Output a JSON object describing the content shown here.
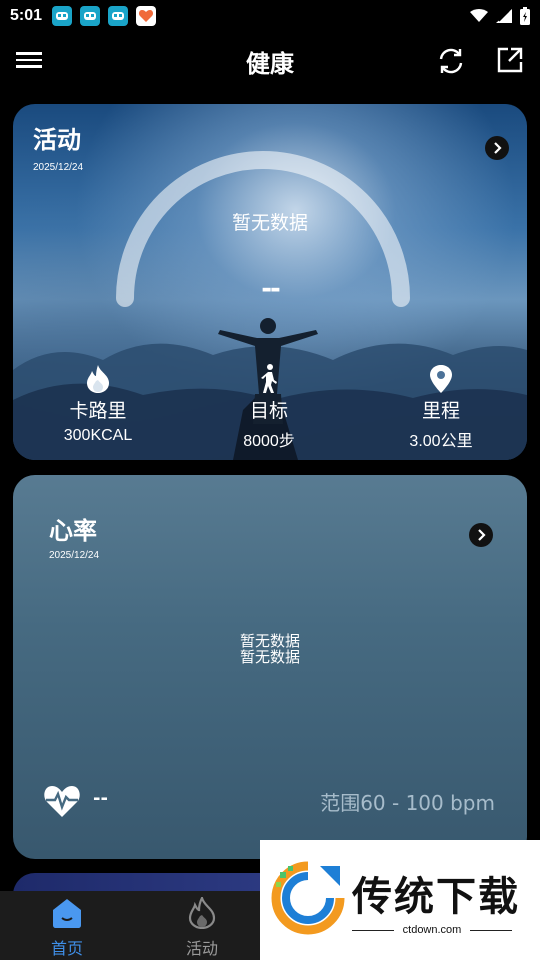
{
  "status_bar": {
    "time": "5:01"
  },
  "header": {
    "title": "健康"
  },
  "activity": {
    "title": "活动",
    "date": "2025/12/24",
    "gauge_text": "暂无数据",
    "gauge_value": "--",
    "stats": [
      {
        "icon": "flame-icon",
        "label": "卡路里",
        "value": "300KCAL"
      },
      {
        "icon": "walker-icon",
        "label": "目标",
        "value": "8000步"
      },
      {
        "icon": "location-pin-icon",
        "label": "里程",
        "value": "3.00公里"
      }
    ]
  },
  "heart_rate": {
    "title": "心率",
    "date": "2025/12/24",
    "no_data_1": "暂无数据",
    "no_data_2": "暂无数据",
    "value": "--",
    "range": "范围60 - 100 bpm"
  },
  "bottom_nav": [
    {
      "label": "首页",
      "icon": "home-icon",
      "active": true
    },
    {
      "label": "活动",
      "icon": "flame-icon",
      "active": false
    }
  ],
  "watermark": {
    "brand": "传统下载",
    "url": "ctdown.com"
  },
  "colors": {
    "accent": "#3f8fe8",
    "nav_bg": "#1c1c1c",
    "heart_card": "#466a81"
  }
}
